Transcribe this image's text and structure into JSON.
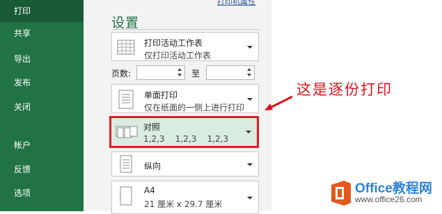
{
  "nav": {
    "items": [
      {
        "label": "打印",
        "active": true
      },
      {
        "label": "共享"
      },
      {
        "label": "导出"
      },
      {
        "label": "发布"
      },
      {
        "label": "关闭"
      },
      {
        "label": "帐户"
      },
      {
        "label": "反馈"
      },
      {
        "label": "选项"
      }
    ]
  },
  "printer_properties_link": "打印机属性",
  "settings": {
    "title": "设置",
    "print_what": {
      "main": "打印活动工作表",
      "sub": "仅打印活动工作表"
    },
    "pages": {
      "label": "页数:",
      "to_label": "至",
      "from_value": "",
      "to_value": ""
    },
    "sides": {
      "main": "单面打印",
      "sub": "仅在纸面的一侧上进行打印"
    },
    "collation": {
      "main": "对照",
      "sub": "1,2,3    1,2,3    1,2,3"
    },
    "orientation": {
      "main": "纵向"
    },
    "paper": {
      "main": "A4",
      "sub": "21 厘米 x 29.7 厘米"
    }
  },
  "annotation": {
    "text": "这是逐份打印",
    "color": "#d9121b"
  },
  "logo": {
    "title": "Office教程网",
    "url": "www.office26.com"
  },
  "colors": {
    "nav_bg": "#217346",
    "accent": "#217346",
    "highlight_border": "#e01b24",
    "selected_bg": "#d9ecdf"
  }
}
